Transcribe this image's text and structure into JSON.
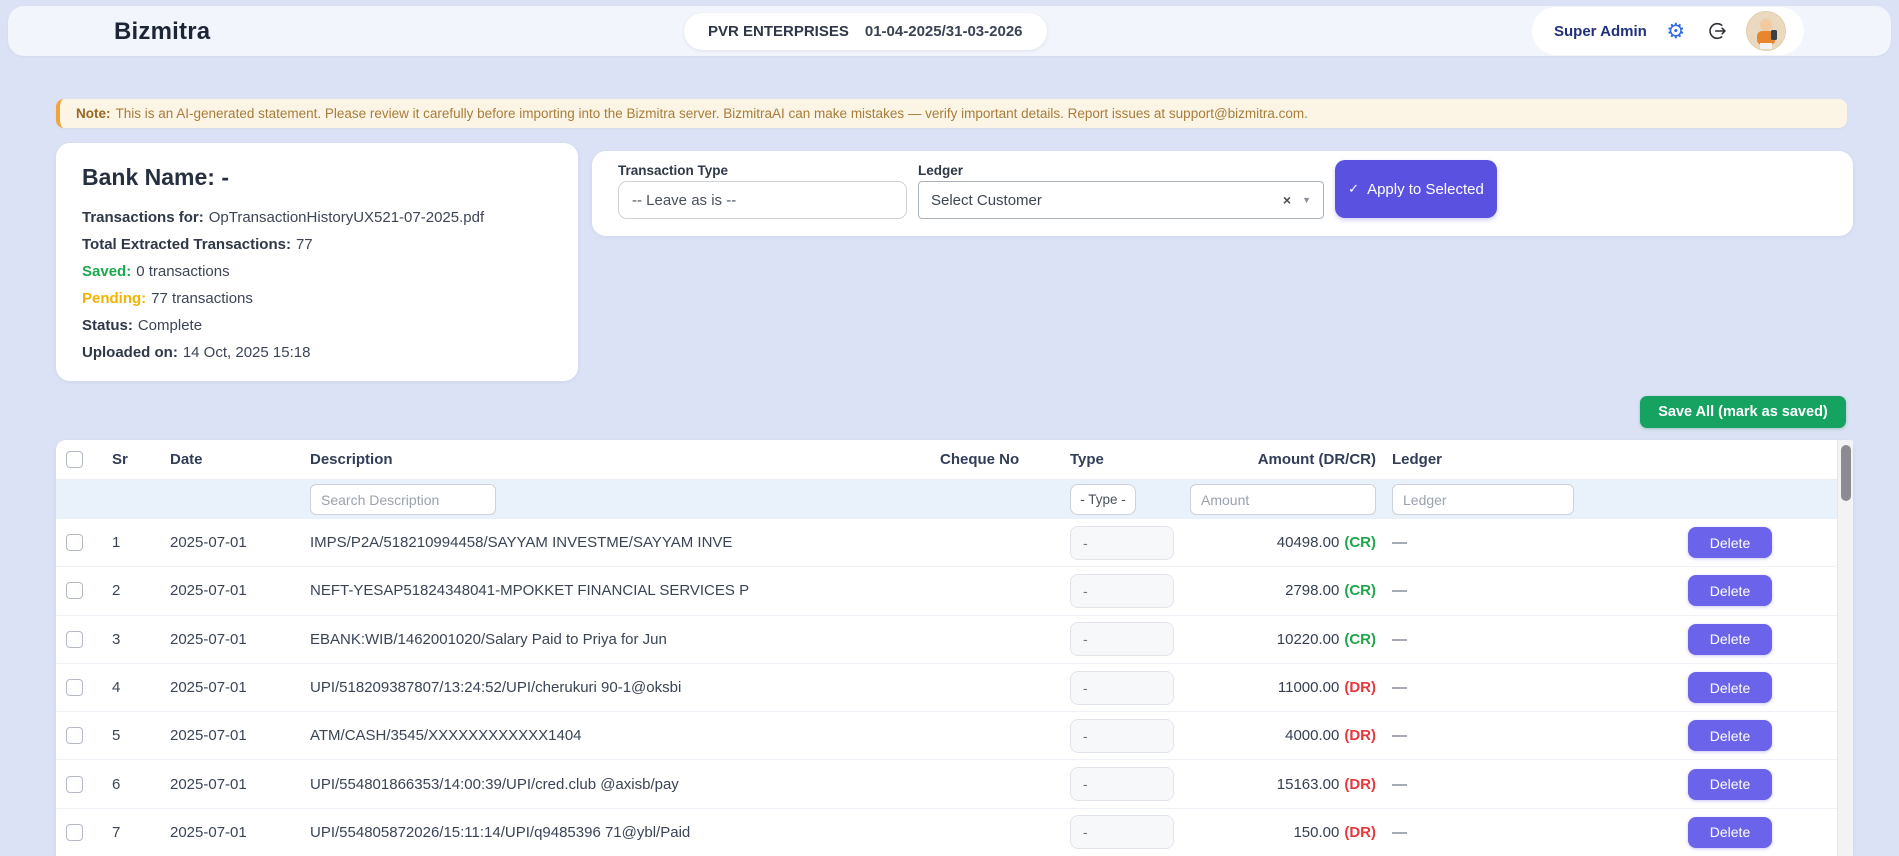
{
  "app": {
    "name": "Bizmitra"
  },
  "header": {
    "company": "PVR ENTERPRISES",
    "fiscal_period": "01-04-2025/31-03-2026",
    "user_role": "Super Admin"
  },
  "note": {
    "label": "Note:",
    "text": "This is an AI-generated statement. Please review it carefully before importing into the Bizmitra server. BizmitraAI can make mistakes — verify important details. Report issues at support@bizmitra.com."
  },
  "statement": {
    "title": "Bank Name: -",
    "items": [
      {
        "label": "Transactions for:",
        "value": "OpTransactionHistoryUX521-07-2025.pdf",
        "cls": ""
      },
      {
        "label": "Total Extracted Transactions:",
        "value": "77",
        "cls": ""
      },
      {
        "label": "Saved:",
        "value": "0 transactions",
        "cls": "green"
      },
      {
        "label": "Pending:",
        "value": "77 transactions",
        "cls": "amber"
      },
      {
        "label": "Status:",
        "value": "Complete",
        "cls": ""
      },
      {
        "label": "Uploaded on:",
        "value": "14 Oct, 2025 15:18",
        "cls": ""
      }
    ]
  },
  "bulk_actions": {
    "transaction_type_label": "Transaction Type",
    "transaction_type_value": "-- Leave as is --",
    "ledger_label": "Ledger",
    "ledger_value": "Select Customer",
    "clear_icon": "×",
    "caret_icon": "▼",
    "apply_check": "✓",
    "apply_label": "Apply to Selected"
  },
  "save_all_label": "Save All (mark as saved)",
  "table": {
    "headers": {
      "sr": "Sr",
      "date": "Date",
      "description": "Description",
      "cheque": "Cheque No",
      "type": "Type",
      "amount": "Amount (DR/CR)",
      "ledger": "Ledger"
    },
    "filters": {
      "description_placeholder": "Search Description",
      "type_value": "- Type -",
      "amount_placeholder": "Amount",
      "ledger_placeholder": "Ledger"
    },
    "delete_label": "Delete"
  },
  "rows": [
    {
      "sr": "1",
      "date": "2025-07-01",
      "description": "IMPS/P2A/518210994458/SAYYAM INVESTME/SAYYAM INVE",
      "cheque": "",
      "type": "-",
      "amount": "40498.00",
      "drcr": "(CR)",
      "drcr_class": "cr",
      "ledger": "—"
    },
    {
      "sr": "2",
      "date": "2025-07-01",
      "description": "NEFT-YESAP51824348041-MPOKKET FINANCIAL SERVICES P",
      "cheque": "",
      "type": "-",
      "amount": "2798.00",
      "drcr": "(CR)",
      "drcr_class": "cr",
      "ledger": "—"
    },
    {
      "sr": "3",
      "date": "2025-07-01",
      "description": "EBANK:WIB/1462001020/Salary Paid to Priya for Jun",
      "cheque": "",
      "type": "-",
      "amount": "10220.00",
      "drcr": "(CR)",
      "drcr_class": "cr",
      "ledger": "—"
    },
    {
      "sr": "4",
      "date": "2025-07-01",
      "description": "UPI/518209387807/13:24:52/UPI/cherukuri 90-1@oksbi",
      "cheque": "",
      "type": "-",
      "amount": "11000.00",
      "drcr": "(DR)",
      "drcr_class": "dr",
      "ledger": "—"
    },
    {
      "sr": "5",
      "date": "2025-07-01",
      "description": "ATM/CASH/3545/XXXXXXXXXXXX1404",
      "cheque": "",
      "type": "-",
      "amount": "4000.00",
      "drcr": "(DR)",
      "drcr_class": "dr",
      "ledger": "—"
    },
    {
      "sr": "6",
      "date": "2025-07-01",
      "description": "UPI/554801866353/14:00:39/UPI/cred.club @axisb/pay",
      "cheque": "",
      "type": "-",
      "amount": "15163.00",
      "drcr": "(DR)",
      "drcr_class": "dr",
      "ledger": "—"
    },
    {
      "sr": "7",
      "date": "2025-07-01",
      "description": "UPI/554805872026/15:11:14/UPI/q9485396 71@ybl/Paid",
      "cheque": "",
      "type": "-",
      "amount": "150.00",
      "drcr": "(DR)",
      "drcr_class": "dr",
      "ledger": "—"
    }
  ],
  "colors": {
    "accent_indigo": "#5b51e1",
    "delete_indigo": "#6b63ea",
    "save_green": "#16a362",
    "credit_green": "#1fa64a",
    "debit_red": "#e8373d",
    "note_orange": "#f2a33c"
  }
}
